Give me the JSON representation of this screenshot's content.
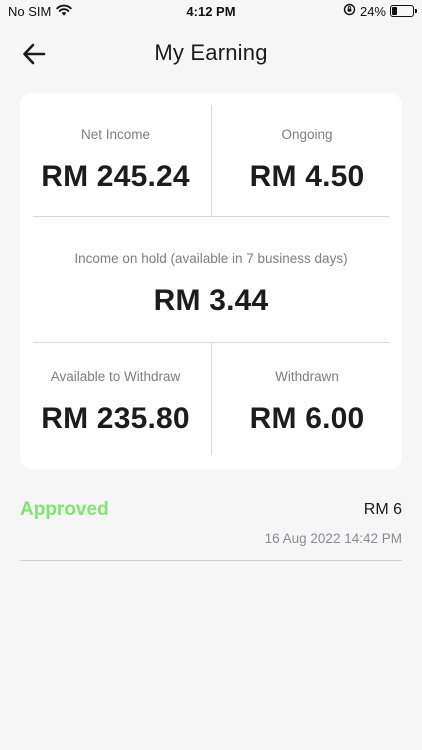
{
  "status_bar": {
    "carrier": "No SIM",
    "time": "4:12 PM",
    "battery_percent": "24%",
    "battery_level": 0.24,
    "icons": [
      "wifi-icon",
      "rotation-lock-icon",
      "battery-icon"
    ]
  },
  "header": {
    "back_icon": "arrow-left-icon",
    "title": "My Earning"
  },
  "summary": {
    "net_income": {
      "label": "Net Income",
      "value": "RM 245.24"
    },
    "ongoing": {
      "label": "Ongoing",
      "value": "RM 4.50"
    },
    "on_hold": {
      "label": "Income on hold (available in 7 business days)",
      "value": "RM 3.44"
    },
    "available": {
      "label": "Available to Withdraw",
      "value": "RM 235.80"
    },
    "withdrawn": {
      "label": "Withdrawn",
      "value": "RM 6.00"
    }
  },
  "transactions": [
    {
      "status": "Approved",
      "amount": "RM 6",
      "date": "16 Aug 2022 14:42 PM"
    }
  ],
  "colors": {
    "approved": "#7ee66e",
    "background": "#f6f6f6",
    "card": "#ffffff",
    "label": "#7d7d86"
  }
}
